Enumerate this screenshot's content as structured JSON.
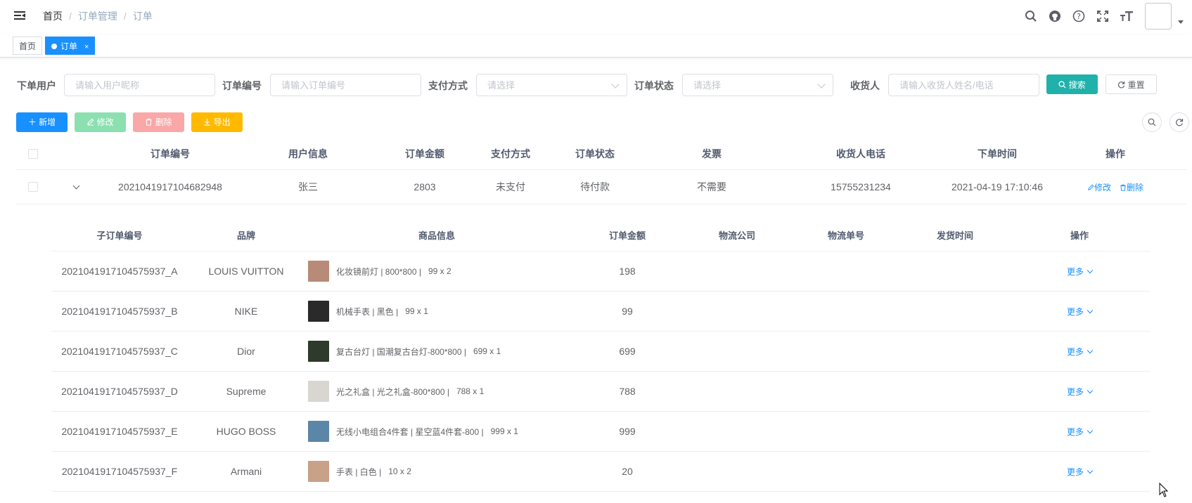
{
  "breadcrumb": {
    "home": "首页",
    "level1": "订单管理",
    "level2": "订单"
  },
  "navbar": {
    "icons": [
      "search-icon",
      "github-icon",
      "help-icon",
      "fullscreen-icon",
      "font-size-icon"
    ]
  },
  "tags": [
    {
      "label": "首页",
      "active": false
    },
    {
      "label": "订单",
      "active": true,
      "close": "×"
    }
  ],
  "search": {
    "user_label": "下单用户",
    "user_placeholder": "请输入用户昵称",
    "order_no_label": "订单编号",
    "order_no_placeholder": "请输入订单编号",
    "payment_label": "支付方式",
    "payment_placeholder": "请选择",
    "status_label": "订单状态",
    "status_placeholder": "请选择",
    "receiver_label": "收货人",
    "receiver_placeholder": "请输入收货人姓名/电话",
    "search_button": "搜索",
    "reset_button": "重置"
  },
  "toolbar": {
    "add": "新增",
    "edit": "修改",
    "delete": "删除",
    "export": "导出"
  },
  "colors": {
    "primary": "#1890ff",
    "search": "#20b2aa",
    "success_light": "#8ce0b0",
    "danger_light": "#f9a7a7",
    "warning": "#ffba00"
  },
  "main_table": {
    "columns": [
      "订单编号",
      "用户信息",
      "订单金额",
      "支付方式",
      "订单状态",
      "发票",
      "收货人电话",
      "下单时间",
      "操作"
    ],
    "row": {
      "order_no": "2021041917104682948",
      "user": "张三",
      "amount": "2803",
      "payment": "未支付",
      "status": "待付款",
      "invoice": "不需要",
      "phone": "15755231234",
      "time": "2021-04-19 17:10:46",
      "edit": "修改",
      "delete": "删除"
    }
  },
  "sub_table": {
    "columns": [
      "子订单编号",
      "品牌",
      "商品信息",
      "订单金额",
      "物流公司",
      "物流单号",
      "发货时间",
      "操作"
    ],
    "more_label": "更多",
    "rows": [
      {
        "sub_no": "2021041917104575937_A",
        "brand": "LOUIS VUITTON",
        "goods": "化妆镜前灯 | 800*800 |",
        "qty": "99 x 2",
        "amount": "198",
        "thumb_color": "#b88b78"
      },
      {
        "sub_no": "2021041917104575937_B",
        "brand": "NIKE",
        "goods": "机械手表 | 黑色 |",
        "qty": "99 x 1",
        "amount": "99",
        "thumb_color": "#2a2a2a"
      },
      {
        "sub_no": "2021041917104575937_C",
        "brand": "Dior",
        "goods": "复古台灯 | 国潮复古台灯-800*800 |",
        "qty": "699 x 1",
        "amount": "699",
        "thumb_color": "#2d3a2c"
      },
      {
        "sub_no": "2021041917104575937_D",
        "brand": "Supreme",
        "goods": "光之礼盒 | 光之礼盒-800*800 |",
        "qty": "788 x 1",
        "amount": "788",
        "thumb_color": "#d9d6d2"
      },
      {
        "sub_no": "2021041917104575937_E",
        "brand": "HUGO BOSS",
        "goods": "无线小电组合4件套 | 星空蓝4件套-800 |",
        "qty": "999 x 1",
        "amount": "999",
        "thumb_color": "#5b86a8"
      },
      {
        "sub_no": "2021041917104575937_F",
        "brand": "Armani",
        "goods": "手表 | 白色 |",
        "qty": "10 x 2",
        "amount": "20",
        "thumb_color": "#c9a088"
      }
    ]
  }
}
